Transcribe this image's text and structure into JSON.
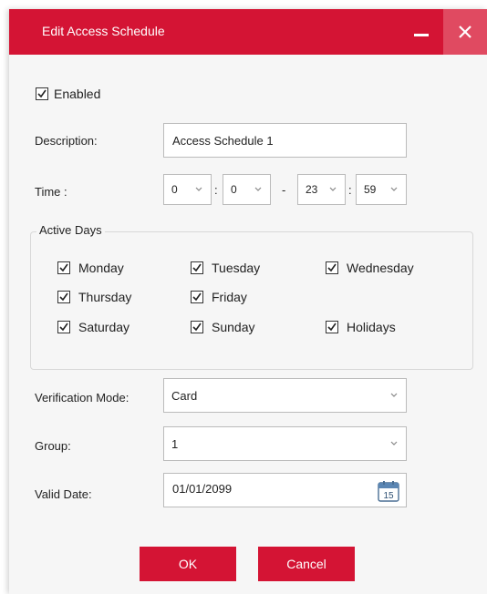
{
  "dialog": {
    "title": "Edit Access Schedule",
    "accent_color": "#d41434",
    "close_hover_color": "#e04a61"
  },
  "enabled": {
    "label": "Enabled",
    "checked": true
  },
  "description": {
    "label": "Description:",
    "value": "Access Schedule 1"
  },
  "time": {
    "label": "Time :",
    "start_hour": "0",
    "start_minute": "0",
    "separator": ":",
    "range_separator": "-",
    "end_hour": "23",
    "end_minute": "59"
  },
  "active_days": {
    "legend": "Active Days",
    "days": [
      {
        "label": "Monday",
        "checked": true
      },
      {
        "label": "Tuesday",
        "checked": true
      },
      {
        "label": "Wednesday",
        "checked": true
      },
      {
        "label": "Thursday",
        "checked": true
      },
      {
        "label": "Friday",
        "checked": true
      },
      {
        "label": "Saturday",
        "checked": true
      },
      {
        "label": "Sunday",
        "checked": true
      },
      {
        "label": "Holidays",
        "checked": true
      }
    ]
  },
  "verification_mode": {
    "label": "Verification Mode:",
    "value": "Card"
  },
  "group": {
    "label": "Group:",
    "value": "1"
  },
  "valid_date": {
    "label": "Valid Date:",
    "value": "01/01/2099",
    "calendar_day": "15"
  },
  "buttons": {
    "ok": "OK",
    "cancel": "Cancel"
  }
}
